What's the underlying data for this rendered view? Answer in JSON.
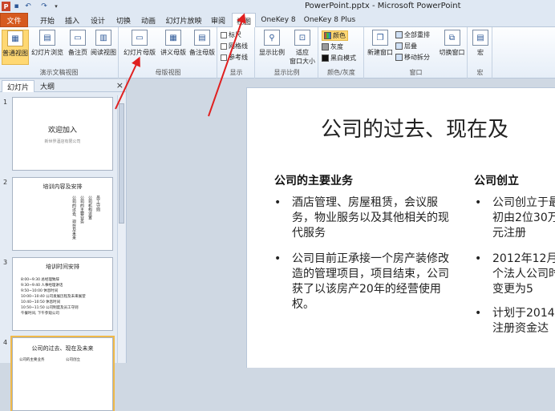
{
  "window": {
    "title": "PowerPoint.pptx - Microsoft PowerPoint",
    "app_icon": "P"
  },
  "quick_access": {
    "undo_label": "↶",
    "redo_label": "↷",
    "save_label": "▪",
    "more_label": "▾"
  },
  "tabs": [
    {
      "label": "文件",
      "active": false
    },
    {
      "label": "开始"
    },
    {
      "label": "插入"
    },
    {
      "label": "设计"
    },
    {
      "label": "切换"
    },
    {
      "label": "动画"
    },
    {
      "label": "幻灯片放映"
    },
    {
      "label": "审阅"
    },
    {
      "label": "视图",
      "active": true
    },
    {
      "label": "OneKey 8"
    },
    {
      "label": "OneKey 8 Plus"
    }
  ],
  "ribbon": {
    "presentation_views": {
      "label": "演示文稿视图",
      "buttons": [
        "普通视图",
        "幻灯片浏览",
        "备注页",
        "阅读视图"
      ]
    },
    "master_views": {
      "label": "母版视图",
      "buttons": [
        "幻灯片母版",
        "讲义母版",
        "备注母版"
      ]
    },
    "show": {
      "label": "显示",
      "items": [
        "标尺",
        "网格线",
        "参考线"
      ]
    },
    "zoom": {
      "label": "显示比例",
      "buttons": [
        "显示比例",
        "适应\n窗口大小"
      ]
    },
    "color": {
      "label": "颜色/灰度",
      "items": [
        "颜色",
        "灰度",
        "黑白模式"
      ]
    },
    "window": {
      "label": "窗口",
      "new_window": "新建窗口",
      "items": [
        "全部重排",
        "层叠",
        "移动拆分"
      ],
      "switch": "切换窗口"
    },
    "macro": {
      "label": "宏",
      "button": "宏"
    }
  },
  "left_panel": {
    "tabs": [
      "幻灯片",
      "大纲"
    ],
    "close_label": "×",
    "slides": [
      {
        "number": "1",
        "title": "欢迎加入",
        "subtitle": "新世界酒店有限公司"
      },
      {
        "number": "2",
        "title": "培训内容及安排",
        "lines": [
          "公司的过去、现在及未来",
          "公司的主要业务",
          "公司机构设置",
          "员工守则"
        ]
      },
      {
        "number": "3",
        "title": "培训时间安排",
        "lines": [
          "8:00~9:30  总经理致辞",
          "9:30~9:40  人事经理讲话",
          "9:50~10:00  休息时间",
          "10:00~10:40  公司发展历程及未来展望",
          "10:40~10:50  休息时间",
          "10:50~11:50  公司制度及员工守则",
          "午餐时间, 下午参观公司"
        ]
      },
      {
        "number": "4",
        "title": "公司的过去、现在及未来",
        "lines": [
          "公司的主要业务",
          "公司创立"
        ]
      }
    ]
  },
  "slide": {
    "title": "公司的过去、现在及",
    "left_heading": "公司的主要业务",
    "left_bullets": [
      "酒店管理、房屋租赁，会议服务，物业服务以及其他相关的现代服务",
      "公司目前正承接一个房产装修改造的管理项目，项目结束，公司获了以该房产20年的经营使用权。"
    ],
    "right_heading": "公司创立",
    "right_bullets": [
      "公司创立于最初由2位30万元注册",
      "2012年12月个法人公司时变更为5",
      "计划于2014注册资金达"
    ],
    "bullet_char": "•"
  }
}
